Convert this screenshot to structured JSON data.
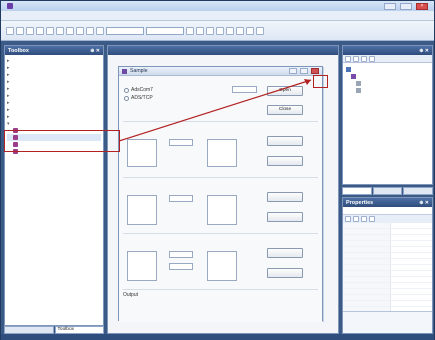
{
  "window": {
    "title": "",
    "controls": [
      "",
      "",
      "×"
    ]
  },
  "menu": [
    "",
    "",
    "",
    "",
    "",
    "",
    "",
    "",
    "",
    "",
    "",
    ""
  ],
  "toolbar": {
    "combo_1": "",
    "combo_2": ""
  },
  "toolbox": {
    "title": "Toolbox",
    "sections": [
      {
        "label": ""
      },
      {
        "label": ""
      },
      {
        "label": ""
      },
      {
        "label": ""
      },
      {
        "label": ""
      },
      {
        "label": ""
      },
      {
        "label": ""
      },
      {
        "label": ""
      },
      {
        "label": ""
      },
      {
        "label": ""
      }
    ],
    "entries": [
      {
        "label": ""
      },
      {
        "label": "",
        "active": true
      },
      {
        "label": ""
      },
      {
        "label": ""
      }
    ],
    "bottom_tabs": [
      "",
      "Toolbox"
    ]
  },
  "designer": {
    "tab_label": "",
    "form_title": "Sample",
    "form": {
      "labels": {
        "server": "",
        "ads_com": "AdsCom7",
        "ads_tcp": "ADS/TCP",
        "logical": "",
        "open": "Open",
        "close": "Close",
        "transfer_single": "",
        "transfer_col_1": "",
        "transfer_col_2": "",
        "transfer_col_3": "",
        "block_read": "",
        "block_col_1": "",
        "block_col_2": "",
        "block_col_3": "",
        "block_write": "",
        "block_wcol_1": "",
        "block_wcol_2": "",
        "block_wcol_3": "",
        "output": "Output",
        "result": "",
        "data": "",
        "status": ""
      },
      "buttons": [
        "",
        "",
        "",
        "",
        "",
        ""
      ]
    }
  },
  "solution": {
    "title": "",
    "tree": [
      {
        "label": ""
      },
      {
        "label": ""
      },
      {
        "label": ""
      },
      {
        "label": ""
      }
    ],
    "tabs": [
      "",
      "",
      ""
    ]
  },
  "properties": {
    "title": "Properties",
    "target": "",
    "rows": [
      {
        "k": "",
        "v": ""
      },
      {
        "k": "",
        "v": ""
      },
      {
        "k": "",
        "v": ""
      },
      {
        "k": "",
        "v": ""
      },
      {
        "k": "",
        "v": ""
      },
      {
        "k": "",
        "v": ""
      },
      {
        "k": "",
        "v": ""
      },
      {
        "k": "",
        "v": ""
      },
      {
        "k": "",
        "v": ""
      },
      {
        "k": "",
        "v": ""
      },
      {
        "k": "",
        "v": ""
      },
      {
        "k": "",
        "v": ""
      },
      {
        "k": "",
        "v": ""
      },
      {
        "k": "",
        "v": ""
      },
      {
        "k": "",
        "v": ""
      }
    ],
    "description_title": "",
    "description_text": ""
  },
  "status_bar": ""
}
